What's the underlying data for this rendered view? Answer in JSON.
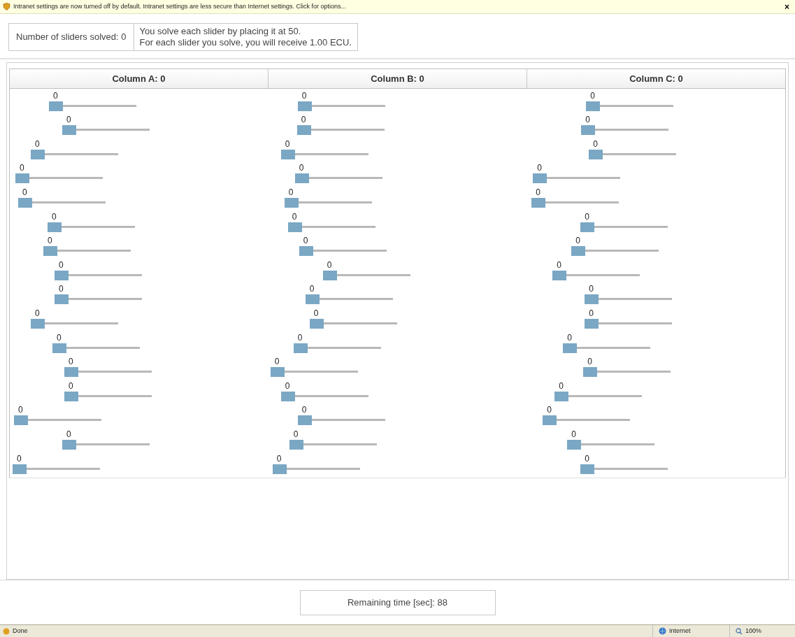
{
  "info_bar": {
    "text": "Intranet settings are now turned off by default. Intranet settings are less secure than Internet settings. Click for options...",
    "close": "×"
  },
  "summary": {
    "solved": "Number of sliders solved: 0",
    "instructions": [
      "You solve each slider by placing it at 50.",
      "For each slider you solve, you will receive 1.00 ECU."
    ]
  },
  "columns": [
    {
      "header": "Column A: 0",
      "sliders": [
        {
          "value": "0",
          "level": 0
        },
        {
          "value": "0",
          "level": 0
        },
        {
          "value": "0",
          "level": 0
        },
        {
          "value": "0",
          "level": 0
        },
        {
          "value": "0",
          "level": 0
        },
        {
          "value": "0",
          "level": 0
        },
        {
          "value": "0",
          "level": 0
        },
        {
          "value": "0",
          "level": 0
        },
        {
          "value": "0",
          "level": 0
        },
        {
          "value": "0",
          "level": 0
        },
        {
          "value": "0",
          "level": 0
        },
        {
          "value": "0",
          "level": 0
        },
        {
          "value": "0",
          "level": 0
        },
        {
          "value": "0",
          "level": 0
        },
        {
          "value": "0",
          "level": 0
        },
        {
          "value": "0",
          "level": 0
        }
      ]
    },
    {
      "header": "Column B: 0",
      "sliders": [
        {
          "value": "0",
          "level": 0
        },
        {
          "value": "0",
          "level": 0
        },
        {
          "value": "0",
          "level": 0
        },
        {
          "value": "0",
          "level": 0
        },
        {
          "value": "0",
          "level": 0
        },
        {
          "value": "0",
          "level": 0
        },
        {
          "value": "0",
          "level": 0
        },
        {
          "value": "0",
          "level": 0
        },
        {
          "value": "0",
          "level": 0
        },
        {
          "value": "0",
          "level": 0
        },
        {
          "value": "0",
          "level": 0
        },
        {
          "value": "0",
          "level": 0
        },
        {
          "value": "0",
          "level": 0
        },
        {
          "value": "0",
          "level": 0
        },
        {
          "value": "0",
          "level": 0
        },
        {
          "value": "0",
          "level": 0
        }
      ]
    },
    {
      "header": "Column C: 0",
      "sliders": [
        {
          "value": "0",
          "level": 0
        },
        {
          "value": "0",
          "level": 0
        },
        {
          "value": "0",
          "level": 0
        },
        {
          "value": "0",
          "level": 0
        },
        {
          "value": "0",
          "level": 0
        },
        {
          "value": "0",
          "level": 0
        },
        {
          "value": "0",
          "level": 0
        },
        {
          "value": "0",
          "level": 0
        },
        {
          "value": "0",
          "level": 0
        },
        {
          "value": "0",
          "level": 0
        },
        {
          "value": "0",
          "level": 0
        },
        {
          "value": "0",
          "level": 0
        },
        {
          "value": "0",
          "level": 0
        },
        {
          "value": "0",
          "level": 0
        },
        {
          "value": "0",
          "level": 0
        },
        {
          "value": "0",
          "level": 0
        }
      ]
    }
  ],
  "timer": "Remaining time [sec]: 88",
  "status_bar": {
    "status": "Done",
    "zone": "Internet",
    "zoom": "100%"
  }
}
